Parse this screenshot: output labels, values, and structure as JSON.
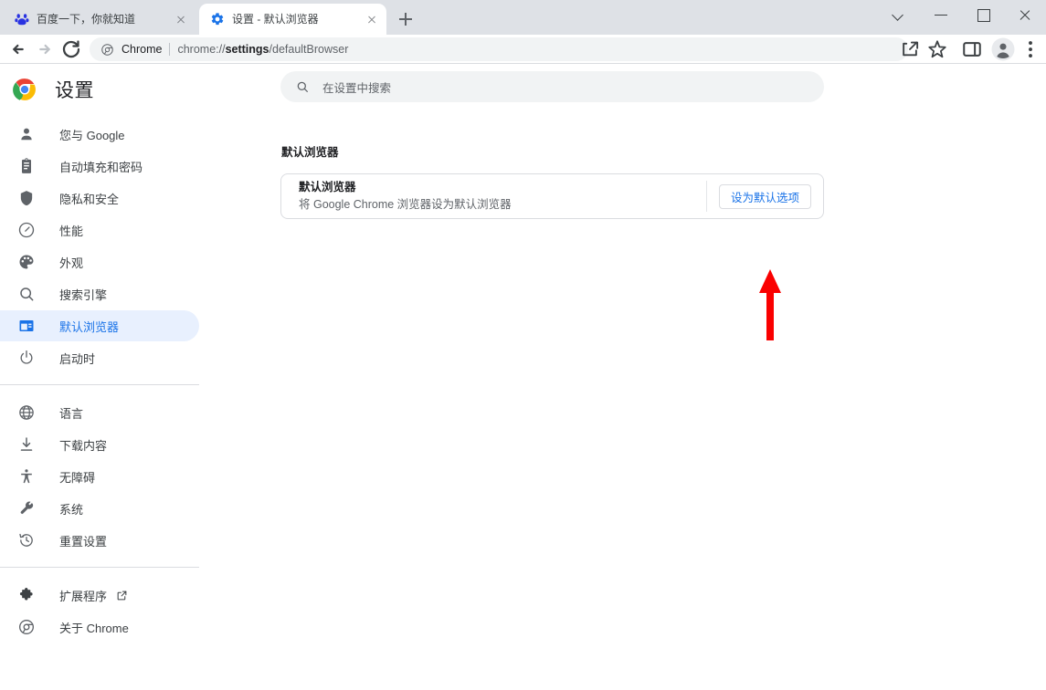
{
  "window": {
    "controls": [
      {
        "name": "tab-search-chevron",
        "icon": "chevron-down-icon"
      },
      {
        "name": "minimize",
        "icon": "minimize-icon"
      },
      {
        "name": "maximize",
        "icon": "maximize-icon"
      },
      {
        "name": "close",
        "icon": "close-icon"
      }
    ]
  },
  "tabs": [
    {
      "title": "百度一下，你就知道",
      "favicon": "baidu-paw-icon",
      "active": false
    },
    {
      "title": "设置 - 默认浏览器",
      "favicon": "settings-gear-icon",
      "active": true
    }
  ],
  "new_tab_label": "+",
  "toolbar": {
    "back_icon": "back-arrow-icon",
    "forward_icon": "forward-arrow-icon",
    "reload_icon": "reload-icon",
    "omnibox": {
      "chip_icon": "chrome-icon",
      "chip_label": "Chrome",
      "url_prefix": "chrome://",
      "url_strong": "settings",
      "url_suffix": "/defaultBrowser"
    },
    "right_icons": [
      {
        "name": "share-icon"
      },
      {
        "name": "bookmark-star-icon"
      },
      {
        "name": "side-panel-icon"
      },
      {
        "name": "profile-avatar-icon"
      },
      {
        "name": "more-menu-icon"
      }
    ]
  },
  "settings": {
    "logo": "chrome-logo",
    "title": "设置",
    "search": {
      "icon": "search-icon",
      "placeholder": "在设置中搜索",
      "value": ""
    },
    "sidebar": [
      {
        "label": "您与 Google",
        "icon": "person-icon",
        "selected": false
      },
      {
        "label": "自动填充和密码",
        "icon": "clipboard-icon",
        "selected": false
      },
      {
        "label": "隐私和安全",
        "icon": "shield-icon",
        "selected": false
      },
      {
        "label": "性能",
        "icon": "speedometer-icon",
        "selected": false
      },
      {
        "label": "外观",
        "icon": "palette-icon",
        "selected": false
      },
      {
        "label": "搜索引擎",
        "icon": "search-icon",
        "selected": false
      },
      {
        "label": "默认浏览器",
        "icon": "browser-window-icon",
        "selected": true
      },
      {
        "label": "启动时",
        "icon": "power-icon",
        "selected": false
      },
      {
        "divider": true
      },
      {
        "label": "语言",
        "icon": "globe-icon",
        "selected": false
      },
      {
        "label": "下载内容",
        "icon": "download-icon",
        "selected": false
      },
      {
        "label": "无障碍",
        "icon": "accessibility-icon",
        "selected": false
      },
      {
        "label": "系统",
        "icon": "wrench-icon",
        "selected": false
      },
      {
        "label": "重置设置",
        "icon": "restore-history-icon",
        "selected": false
      },
      {
        "divider": true
      },
      {
        "label": "扩展程序",
        "icon": "puzzle-icon",
        "selected": false,
        "external": true
      },
      {
        "label": "关于 Chrome",
        "icon": "chrome-outline-icon",
        "selected": false
      }
    ],
    "main": {
      "section_heading": "默认浏览器",
      "card": {
        "title": "默认浏览器",
        "subtitle": "将 Google Chrome 浏览器设为默认浏览器",
        "button_label": "设为默认选项"
      }
    }
  },
  "annotation": {
    "arrow": "red-up-arrow",
    "color": "#fa0000"
  },
  "colors": {
    "accent_blue": "#1a73e8",
    "selected_pill": "#e8f0fe",
    "tabstrip_bg": "#dee1e6",
    "omnibox_bg": "#f1f3f4",
    "border": "#dadce0",
    "text_primary": "#202124",
    "text_secondary": "#5f6368",
    "annotation_red": "#fa0000"
  }
}
